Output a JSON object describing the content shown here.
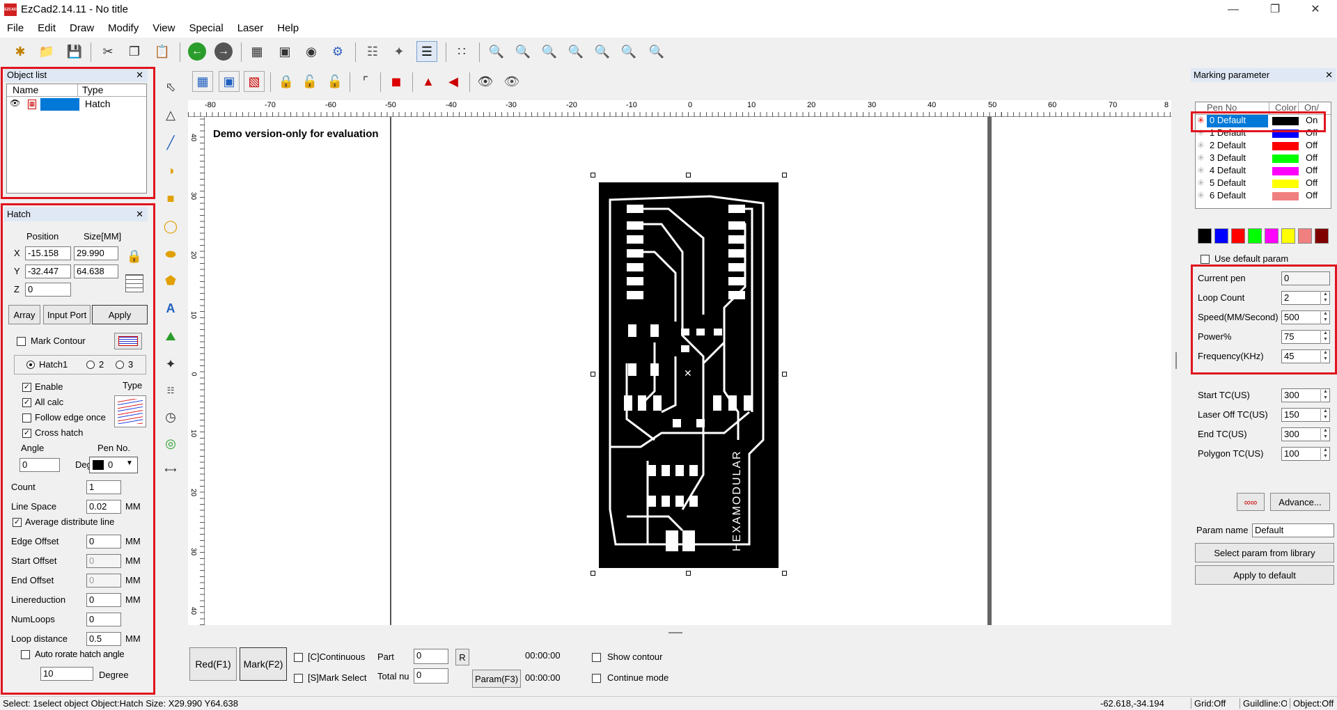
{
  "window": {
    "title": "EzCad2.14.11 - No title",
    "logo": "EZCAD"
  },
  "menu": [
    "File",
    "Edit",
    "Draw",
    "Modify",
    "View",
    "Special",
    "Laser",
    "Help"
  ],
  "object_list": {
    "title": "Object list",
    "columns": [
      "Name",
      "Type"
    ],
    "rows": [
      {
        "name": "",
        "type": "Hatch"
      }
    ]
  },
  "hatch_panel": {
    "title": "Hatch",
    "position_label": "Position",
    "size_label": "Size[MM]",
    "x_label": "X",
    "y_label": "Y",
    "z_label": "Z",
    "x_pos": "-15.158",
    "x_size": "29.990",
    "y_pos": "-32.447",
    "y_size": "64.638",
    "z_pos": "0",
    "array_btn": "Array",
    "input_port_btn": "Input Port",
    "apply_btn": "Apply",
    "mark_contour": "Mark Contour",
    "hatch1": "Hatch1",
    "hatch2": "2",
    "hatch3": "3",
    "enable": "Enable",
    "type_label": "Type",
    "all_calc": "All calc",
    "follow_edge": "Follow edge once",
    "cross_hatch": "Cross hatch",
    "angle_label": "Angle",
    "pen_no_label": "Pen No.",
    "angle_value": "0",
    "deg_label": "Deg",
    "pen_value": "0",
    "count_label": "Count",
    "count_value": "1",
    "line_space_label": "Line Space",
    "line_space_value": "0.02",
    "mm": "MM",
    "avg_line": "Average distribute line",
    "edge_offset_label": "Edge Offset",
    "edge_offset_value": "0",
    "start_offset_label": "Start Offset",
    "start_offset_value": "0",
    "end_offset_label": "End Offset",
    "end_offset_value": "0",
    "linereduction_label": "Linereduction",
    "linereduction_value": "0",
    "numloops_label": "NumLoops",
    "numloops_value": "0",
    "loop_distance_label": "Loop distance",
    "loop_distance_value": "0.5",
    "auto_rotate": "Auto rorate hatch angle",
    "degree_value": "10",
    "degree_label": "Degree"
  },
  "canvas": {
    "demo_text": "Demo version-only for evaluation",
    "pcb_label": "HEXAMODULAR",
    "h_ruler": [
      "-80",
      "-70",
      "-60",
      "-50",
      "-40",
      "-30",
      "-20",
      "-10",
      "0",
      "10",
      "20",
      "30",
      "40",
      "50",
      "60",
      "70",
      "8"
    ],
    "v_ruler": [
      "40",
      "30",
      "20",
      "10",
      "0",
      "10",
      "20",
      "30",
      "40"
    ]
  },
  "bottom_bar": {
    "red_btn": "Red(F1)",
    "mark_btn": "Mark(F2)",
    "continuous": "[C]Continuous",
    "mark_select": "[S]Mark Select",
    "part_label": "Part",
    "part_value": "0",
    "r_btn": "R",
    "total_label": "Total nu",
    "total_value": "0",
    "time1": "00:00:00",
    "time2": "00:00:00",
    "param_btn": "Param(F3)",
    "show_contour": "Show contour",
    "continue_mode": "Continue mode"
  },
  "marking": {
    "title": "Marking parameter",
    "columns": [
      "Pen No",
      "Color",
      "On/"
    ],
    "pens": [
      {
        "name": "0 Default",
        "color": "#000000",
        "state": "On"
      },
      {
        "name": "1 Default",
        "color": "#0000ff",
        "state": "Off"
      },
      {
        "name": "2 Default",
        "color": "#ff0000",
        "state": "Off"
      },
      {
        "name": "3 Default",
        "color": "#00ff00",
        "state": "Off"
      },
      {
        "name": "4 Default",
        "color": "#ff00ff",
        "state": "Off"
      },
      {
        "name": "5 Default",
        "color": "#ffff00",
        "state": "Off"
      },
      {
        "name": "6 Default",
        "color": "#f08080",
        "state": "Off"
      }
    ],
    "palette": [
      "#000000",
      "#0000ff",
      "#ff0000",
      "#00ff00",
      "#ff00ff",
      "#ffff00",
      "#f08080",
      "#800000"
    ],
    "use_default": "Use default param",
    "current_pen_label": "Current pen",
    "current_pen": "0",
    "loop_count_label": "Loop Count",
    "loop_count": "2",
    "speed_label": "Speed(MM/Second)",
    "speed": "500",
    "power_label": "Power%",
    "power": "75",
    "freq_label": "Frequency(KHz)",
    "freq": "45",
    "start_tc_label": "Start TC(US)",
    "start_tc": "300",
    "laser_off_label": "Laser Off TC(US)",
    "laser_off": "150",
    "end_tc_label": "End TC(US)",
    "end_tc": "300",
    "polygon_tc_label": "Polygon TC(US)",
    "polygon_tc": "100",
    "advance_btn": "Advance...",
    "param_name_label": "Param name",
    "param_name": "Default",
    "select_lib_btn": "Select param from library",
    "apply_default_btn": "Apply to default"
  },
  "status": {
    "left": "Select: 1select object Object:Hatch Size: X29.990 Y64.638",
    "coords": "-62.618,-34.194",
    "grid": "Grid:Off",
    "guidline": "Guildline:Off",
    "object": "Object:Off"
  }
}
